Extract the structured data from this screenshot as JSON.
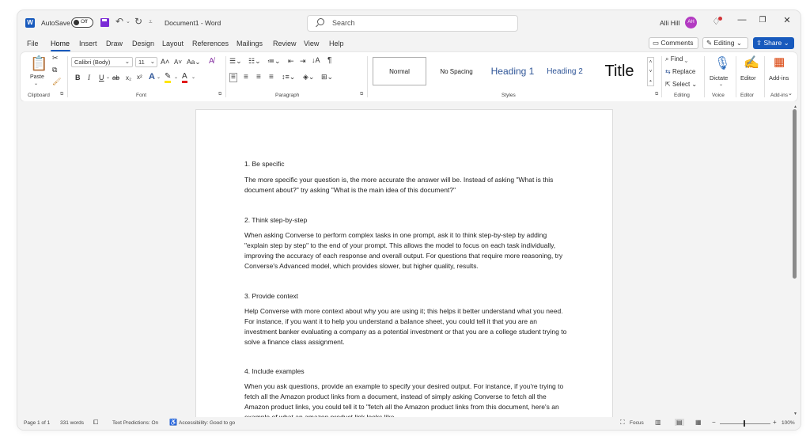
{
  "titlebar": {
    "app_icon": "word-logo-icon",
    "app_letter": "W",
    "autosave_label": "AutoSave",
    "autosave_state": "Off",
    "doc_title": "Document1 - Word",
    "search_placeholder": "Search",
    "user_name": "Alli Hill",
    "user_initials": "AH",
    "min_glyph": "—",
    "max_glyph": "❐",
    "close_glyph": "✕"
  },
  "menu": {
    "items": [
      "File",
      "Home",
      "Insert",
      "Draw",
      "Design",
      "Layout",
      "References",
      "Mailings",
      "Review",
      "View",
      "Help"
    ],
    "active": "Home",
    "comments_label": "Comments",
    "editing_label": "Editing",
    "share_label": "Share"
  },
  "ribbon": {
    "clipboard": {
      "paste_label": "Paste",
      "group_label": "Clipboard"
    },
    "font": {
      "font_name": "Calibri (Body)",
      "font_size": "11",
      "group_label": "Font"
    },
    "paragraph": {
      "group_label": "Paragraph"
    },
    "styles": {
      "items": [
        "Normal",
        "No Spacing",
        "Heading 1",
        "Heading 2",
        "Title"
      ],
      "group_label": "Styles",
      "accent_color": "#2f5597"
    },
    "editing": {
      "find_label": "Find",
      "replace_label": "Replace",
      "select_label": "Select",
      "group_label": "Editing"
    },
    "voice": {
      "dictate_label": "Dictate",
      "group_label": "Voice"
    },
    "editor": {
      "editor_label": "Editor",
      "group_label": "Editor"
    },
    "addins": {
      "addins_label": "Add-ins",
      "group_label": "Add-ins"
    }
  },
  "document": {
    "paragraphs": [
      "1. Be specific",
      "The more specific your question is, the more accurate the answer will be. Instead of asking \"What is this document about?\" try asking \"What is the main idea of this document?\"",
      "2. Think step-by-step",
      "When asking Converse to perform complex tasks in one prompt, ask it to think step-by-step by adding \"explain step by step\" to the end of your prompt. This allows the model to focus on each task individually, improving the accuracy of each response and overall output. For questions that require more reasoning, try Converse's Advanced model, which provides slower, but higher quality, results.",
      "3. Provide context",
      "Help Converse with more context about why you are using it; this helps it better understand what you need. For instance, if you want it to help you understand a balance sheet, you could tell it that you are an investment banker evaluating a company as a potential investment or that you are a college student trying to solve a finance class assignment.",
      "4. Include examples",
      "When you ask questions, provide an example to specify your desired output. For instance, if you're trying to fetch all the Amazon product links from a document, instead of simply asking Converse to fetch all the Amazon product links, you could tell it to \"fetch all the Amazon product links from this document, here's an example of what an amazon product link looks like."
    ]
  },
  "statusbar": {
    "page": "Page 1 of 1",
    "words": "331 words",
    "text_predictions": "Text Predictions: On",
    "accessibility": "Accessibility: Good to go",
    "focus": "Focus",
    "zoom": "100%"
  }
}
